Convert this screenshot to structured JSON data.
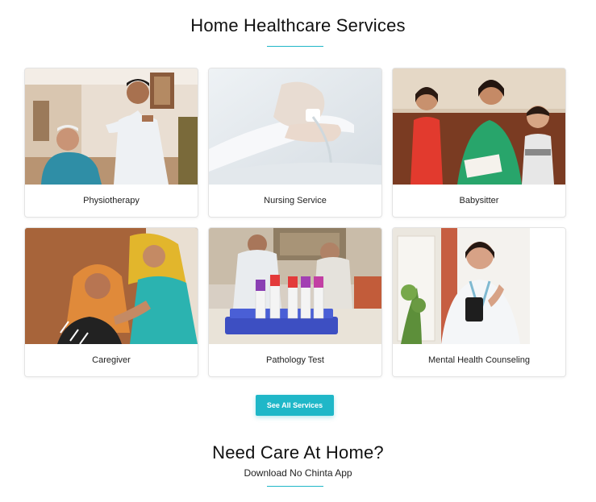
{
  "section": {
    "title": "Home Healthcare Services",
    "accent_color": "#1fb7c8"
  },
  "services": [
    {
      "label": "Physiotherapy",
      "image": "physiotherapy-photo"
    },
    {
      "label": "Nursing Service",
      "image": "nursing-service-photo"
    },
    {
      "label": "Babysitter",
      "image": "babysitter-photo"
    },
    {
      "label": "Caregiver",
      "image": "caregiver-photo"
    },
    {
      "label": "Pathology Test",
      "image": "pathology-test-photo"
    },
    {
      "label": "Mental Health Counseling",
      "image": "mental-health-photo"
    }
  ],
  "see_all_button": {
    "label": "See All Services"
  },
  "cta": {
    "title": "Need Care At Home?",
    "subtitle": "Download No Chinta App"
  }
}
